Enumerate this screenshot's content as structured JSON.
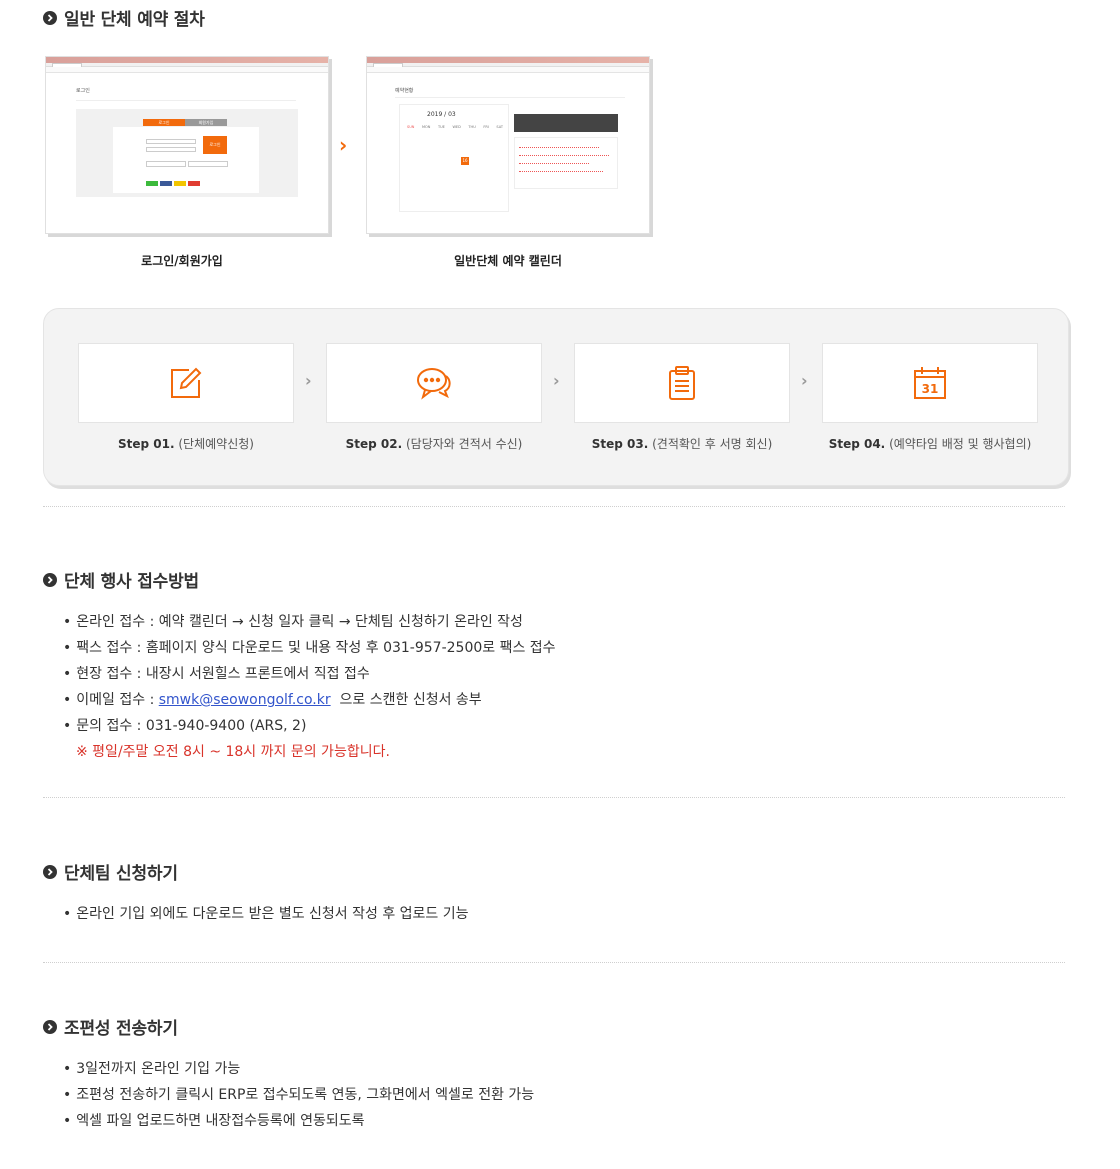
{
  "procedure": {
    "title": "일반 단체 예약 절차",
    "screens": [
      {
        "caption": "로그인/회원가입",
        "thumb_title": "로그인",
        "tabs": [
          "로그인",
          "회원가입"
        ],
        "submit_label": "로그인"
      },
      {
        "caption": "일반단체 예약 캘린더",
        "thumb_title": "예약현황",
        "month": "2019 / 03",
        "weekdays": [
          "SUN",
          "MON",
          "TUE",
          "WED",
          "THU",
          "FRI",
          "SAT"
        ],
        "today": "16"
      }
    ],
    "steps": [
      {
        "label": "Step 01.",
        "desc": "(단체예약신청)",
        "icon": "pencil-edit-icon"
      },
      {
        "label": "Step 02.",
        "desc": "(담당자와 견적서 수신)",
        "icon": "chat-bubbles-icon"
      },
      {
        "label": "Step 03.",
        "desc": "(견적확인 후 서명 회신)",
        "icon": "clipboard-icon"
      },
      {
        "label": "Step 04.",
        "desc": "(예약타임 배정 및 행사협의)",
        "icon": "calendar-icon",
        "icon_text": "31"
      }
    ],
    "accent_color": "#f26a0c"
  },
  "reception": {
    "title": "단체 행사 접수방법",
    "items": [
      "온라인 접수 : 예약 캘린더 → 신청 일자 클릭 → 단체팀 신청하기 온라인 작성",
      "팩스 접수 : 홈페이지 양식 다운로드 및 내용 작성 후 031-957-2500로 팩스 접수",
      "현장 접수 : 내장시 서원힐스 프론트에서 직접 접수"
    ],
    "email_prefix": "이메일 접수 : ",
    "email": "smwk@seowongolf.co.kr",
    "email_suffix": "  으로 스캔한 신청서 송부",
    "inquiry": "문의 접수 : 031-940-9400 (ARS, 2)",
    "note": "※ 평일/주말 오전 8시 ~ 18시 까지 문의 가능합니다."
  },
  "team_apply": {
    "title": "단체팀 신청하기",
    "items": [
      "온라인 기입 외에도 다운로드 받은 별도 신청서 작성 후 업로드 기능"
    ]
  },
  "roster": {
    "title": "조편성 전송하기",
    "items": [
      "3일전까지 온라인 기입 가능",
      "조편성 전송하기 클릭시 ERP로 접수되도록 연동, 그화면에서 엑셀로 전환 가능",
      "엑셀 파일 업로드하면 내장접수등록에 연동되도록"
    ]
  }
}
